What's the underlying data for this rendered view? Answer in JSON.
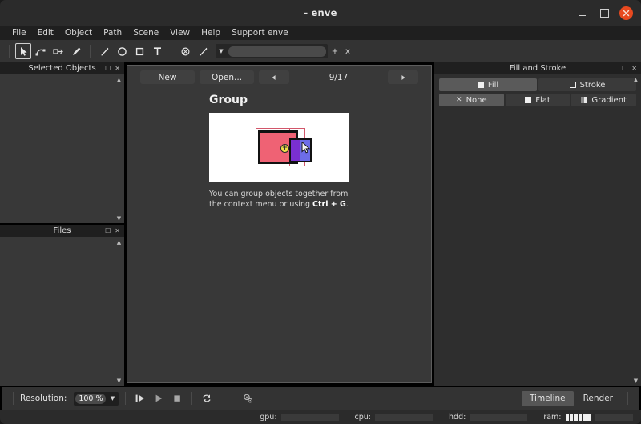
{
  "window": {
    "title": "- enve",
    "minimize_label": "minimize",
    "maximize_label": "maximize",
    "close_label": "x"
  },
  "menubar": {
    "items": [
      {
        "label": "File"
      },
      {
        "label": "Edit"
      },
      {
        "label": "Object"
      },
      {
        "label": "Path"
      },
      {
        "label": "Scene"
      },
      {
        "label": "View"
      },
      {
        "label": "Help"
      },
      {
        "label": "Support enve"
      }
    ]
  },
  "toolbar": {
    "tools": [
      {
        "name": "select-tool",
        "icon": "arrow-cursor-icon",
        "active": true
      },
      {
        "name": "node-edit-tool",
        "icon": "node-edit-icon",
        "active": false
      },
      {
        "name": "transform-tool",
        "icon": "transform-icon",
        "active": false
      },
      {
        "name": "draw-tool",
        "icon": "pencil-icon",
        "active": false
      },
      {
        "name": "line-tool",
        "icon": "line-icon",
        "active": false
      },
      {
        "name": "circle-tool",
        "icon": "circle-icon",
        "active": false
      },
      {
        "name": "rectangle-tool",
        "icon": "square-icon",
        "active": false
      },
      {
        "name": "text-tool",
        "icon": "text-t-icon",
        "active": false
      },
      {
        "name": "null-object-tool",
        "icon": "circle-x-icon",
        "active": false
      },
      {
        "name": "pick-tool",
        "icon": "brush-icon",
        "active": false
      }
    ],
    "combo_value": "",
    "add_label": "+",
    "remove_label": "x"
  },
  "left_docks": [
    {
      "title": "Selected Objects",
      "float_label": "float",
      "close_label": "x",
      "scroll_up": "up",
      "scroll_down": "down",
      "items": []
    },
    {
      "title": "Files",
      "float_label": "float",
      "close_label": "x",
      "scroll_up": "up",
      "scroll_down": "down",
      "items": []
    }
  ],
  "welcome": {
    "new_label": "New",
    "open_label": "Open...",
    "prev_label": "◀",
    "next_label": "▶",
    "page_count": "9/17",
    "tutorial": {
      "title": "Group",
      "description_prefix": "You can group objects together from the context menu or using ",
      "shortcut": "Ctrl + G",
      "description_suffix": ".",
      "illustration": {
        "pink_rect_color": "#ef6274",
        "purple_dark_color": "#7a2fd0",
        "purple_light_color": "#6d6de8",
        "outline_color": "#111111",
        "selection_color": "#d2566a",
        "badge_color": "#f2e24a",
        "badge_label": "+",
        "background": "#ffffff"
      }
    }
  },
  "fill_stroke": {
    "title": "Fill and Stroke",
    "float_label": "float",
    "close_label": "x",
    "scroll_up": "up",
    "target_tabs": [
      {
        "label": "Fill",
        "icon": "filled-square-icon",
        "active": true
      },
      {
        "label": "Stroke",
        "icon": "outlined-square-icon",
        "active": false
      }
    ],
    "paint_types": [
      {
        "label": "None",
        "icon": "x-mark-icon",
        "active": true
      },
      {
        "label": "Flat",
        "icon": "filled-square-icon",
        "active": false
      },
      {
        "label": "Gradient",
        "icon": "gradient-square-icon",
        "active": false
      }
    ]
  },
  "timeline_bar": {
    "resolution_label": "Resolution:",
    "resolution_value": "100 %",
    "resolution_arrow": "▼",
    "buttons": [
      {
        "name": "play-from-start-button",
        "icon": "play-from-start-icon"
      },
      {
        "name": "play-button",
        "icon": "play-icon"
      },
      {
        "name": "stop-button",
        "icon": "stop-square-icon"
      },
      {
        "name": "loop-button",
        "icon": "loop-arrows-icon"
      },
      {
        "name": "local-pivot-button",
        "icon": "pivot-circles-icon"
      }
    ],
    "tabs": [
      {
        "label": "Timeline",
        "active": true
      },
      {
        "label": "Render",
        "active": false
      }
    ]
  },
  "statusbar": {
    "meters": [
      {
        "label": "gpu:",
        "filled_blocks": 0
      },
      {
        "label": "cpu:",
        "filled_blocks": 0
      },
      {
        "label": "hdd:",
        "filled_blocks": 0
      },
      {
        "label": "ram:",
        "filled_blocks": 6
      }
    ]
  }
}
